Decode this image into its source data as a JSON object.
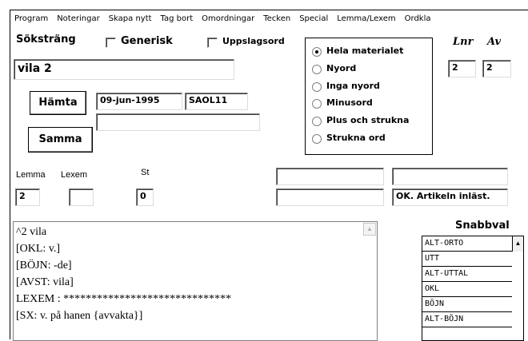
{
  "menu": [
    "Program",
    "Noteringar",
    "Skapa nytt",
    "Tag bort",
    "Omordningar",
    "Tecken",
    "Special",
    "Lemma/Lexem",
    "Ordkla"
  ],
  "search": {
    "label": "Söksträng",
    "generisk_label": "Generisk",
    "uppslagsord_label": "Uppslagsord",
    "value": "vila 2"
  },
  "buttons": {
    "hamta": "Hämta",
    "samma": "Samma"
  },
  "fields": {
    "date": "09-jun-1995",
    "source": "SAOL11",
    "extra": ""
  },
  "scope": {
    "options": [
      "Hela materialet",
      "Nyord",
      "Inga nyord",
      "Minusord",
      "Plus och strukna",
      "Strukna ord"
    ],
    "selected_index": 0
  },
  "counter": {
    "lnr_label": "Lnr",
    "av_label": "Av",
    "lnr_value": "2",
    "av_value": "2"
  },
  "lemma_row": {
    "lemma_label": "Lemma",
    "lexem_label": "Lexem",
    "st_label": "St",
    "lemma_value": "2",
    "lexem_value": "",
    "st_value": "0"
  },
  "status": {
    "field1": "",
    "field2": "",
    "field3": "",
    "message": "OK. Artikeln inläst."
  },
  "article_lines": [
    "^2 vila",
    "[OKL: v.]",
    "[BÖJN: -de]",
    "[AVST: vila]",
    "LEXEM : ******************************",
    "[SX: v. på hanen {avvakta}]"
  ],
  "snabbval": {
    "title": "Snabbval",
    "items": [
      "ALT-ORTO",
      "UTT",
      "ALT-UTTAL",
      "OKL",
      "BÖJN",
      "ALT-BÖJN"
    ]
  }
}
